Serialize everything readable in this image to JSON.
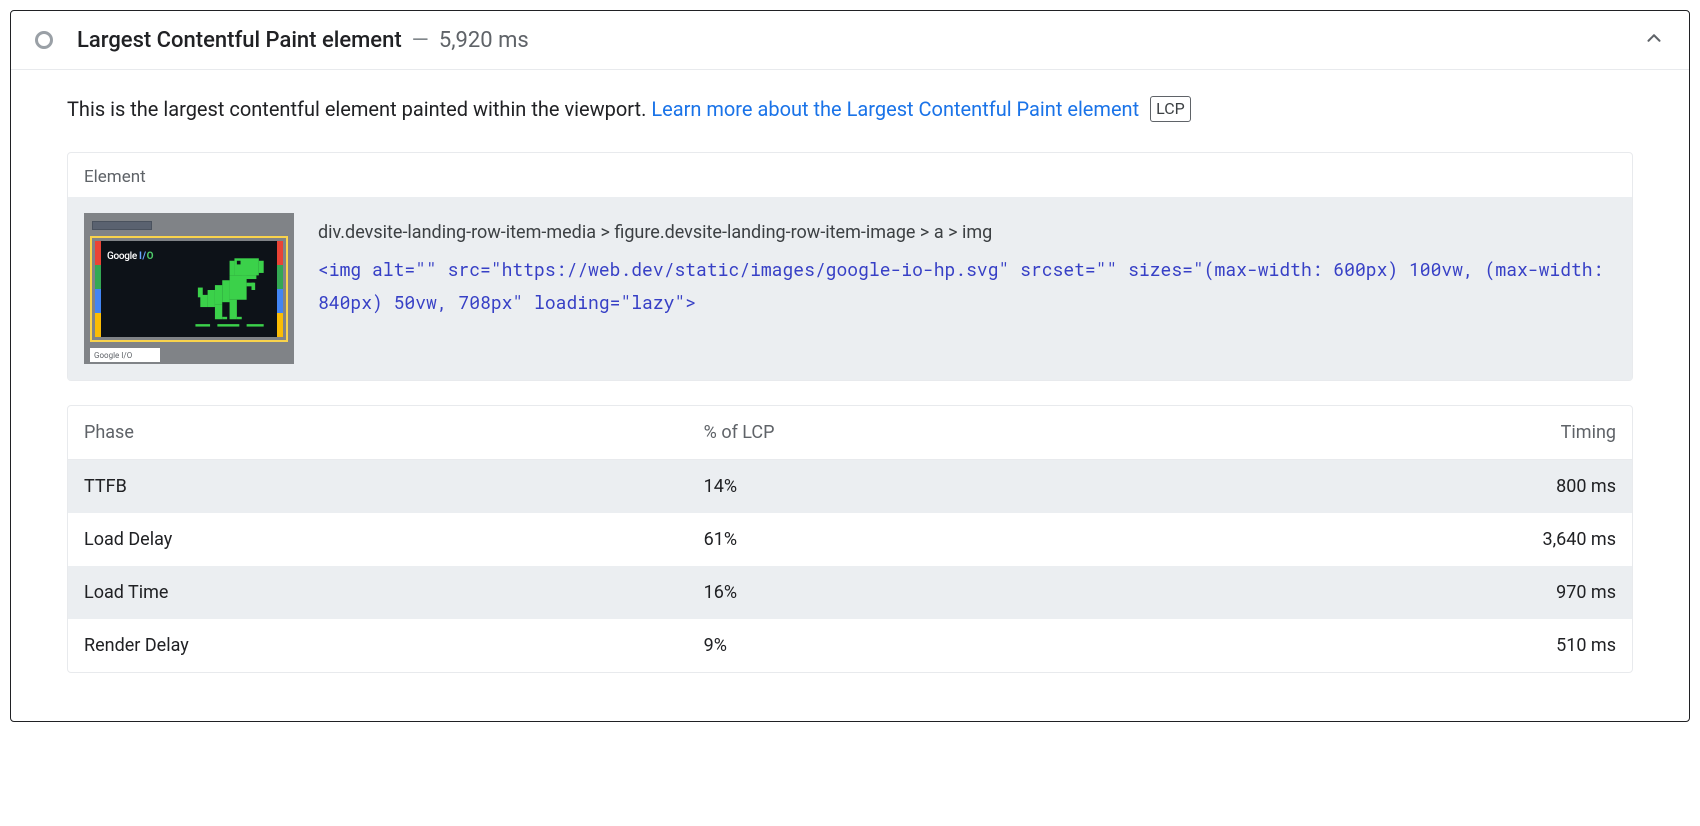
{
  "header": {
    "title": "Largest Contentful Paint element",
    "separator": "—",
    "time": "5,920 ms"
  },
  "description": {
    "text": "This is the largest contentful element painted within the viewport. ",
    "link_text": "Learn more about the Largest Contentful Paint element",
    "badge": "LCP"
  },
  "element_section": {
    "label": "Element",
    "thumb_brand_left": "Google",
    "thumb_brand_right_i": "I/",
    "thumb_brand_right_o": "O",
    "thumb_small_label": "Google I/O",
    "selector": "div.devsite-landing-row-item-media > figure.devsite-landing-row-item-image > a > img",
    "code": "<img alt=\"\" src=\"https://web.dev/static/images/google-io-hp.svg\" srcset=\"\" sizes=\"(max-width: 600px) 100vw, (max-width: 840px) 50vw, 708px\" loading=\"lazy\">"
  },
  "phase_table": {
    "headers": {
      "phase": "Phase",
      "pct": "% of LCP",
      "timing": "Timing"
    },
    "rows": [
      {
        "phase": "TTFB",
        "pct": "14%",
        "timing": "800 ms"
      },
      {
        "phase": "Load Delay",
        "pct": "61%",
        "timing": "3,640 ms"
      },
      {
        "phase": "Load Time",
        "pct": "16%",
        "timing": "970 ms"
      },
      {
        "phase": "Render Delay",
        "pct": "9%",
        "timing": "510 ms"
      }
    ]
  }
}
